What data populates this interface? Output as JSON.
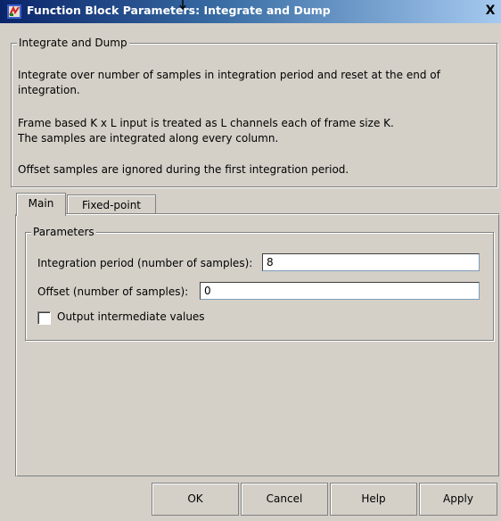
{
  "window": {
    "title": "Function Block Parameters: Integrate and Dump",
    "close_label": "X"
  },
  "description": {
    "group_title": "Integrate and Dump",
    "line1": "Integrate over number of samples in integration period and reset at the end of integration.",
    "line2a": "Frame based K x L input is treated as L channels each of frame size K.",
    "line2b": "The samples are integrated along every column.",
    "line3": "Offset samples are ignored during the first integration period."
  },
  "tabs": [
    {
      "label": "Main",
      "active": true
    },
    {
      "label": "Fixed-point",
      "active": false
    }
  ],
  "parameters": {
    "group_title": "Parameters",
    "integration_period_label": "Integration period (number of samples):",
    "integration_period_value": "8",
    "offset_label": "Offset (number of samples):",
    "offset_value": "0",
    "output_intermediate_label": "Output intermediate values",
    "output_intermediate_checked": false
  },
  "buttons": {
    "ok": "OK",
    "cancel": "Cancel",
    "help": "Help",
    "apply": "Apply"
  },
  "icons": {
    "app": "simulink-block-icon",
    "cursor": "mouse-cursor-icon"
  }
}
